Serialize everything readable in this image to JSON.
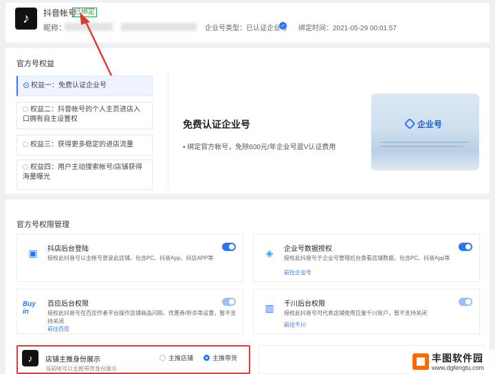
{
  "account": {
    "name": "抖音帐号",
    "badge": "已绑定",
    "nickname_label": "昵称：",
    "type_label": "企业号类型：已认证企业号",
    "bind_time": "绑定时间：2021-05-29 00:01:57"
  },
  "rights": {
    "title": "官方号权益",
    "tabs": [
      {
        "label": "权益一：免费认证企业号"
      },
      {
        "label": "权益二：抖音帐号的个人主页进店入口拥有自主设置权"
      },
      {
        "label": "权益三：获得更多稳定的进店流量"
      },
      {
        "label": "权益四：用户主动搜索帐号/店铺获得海量曝光"
      }
    ],
    "benefit_title": "免费认证企业号",
    "benefit_desc": "• 绑定官方帐号，免除600元/年企业号蓝V认证费用",
    "promo_logo": "企业号"
  },
  "permissions": {
    "title": "官方号权限管理",
    "cards": [
      {
        "title": "抖店后台登陆",
        "desc": "授权此抖音号以主帐号登录此店铺，包含PC、抖音App、抖店APP等",
        "link": "",
        "icon": "doudian-icon"
      },
      {
        "title": "企业号数据授权",
        "desc": "授权此抖音号于企业号管理后台查看店铺数据，包含PC、抖音App等",
        "link": "前往企业号",
        "icon": "enterprise-icon"
      },
      {
        "title": "百应后台权限",
        "desc": "授权此抖音号在百应作者平台操作店铺商品闪购、优惠券/秒杀等设置，暂不支持关闭",
        "link": "前往百应",
        "icon": "buyin-icon"
      },
      {
        "title": "千川后台权限",
        "desc": "授权此抖音号可代表店铺使用巨量千川账户，暂不支持关闭",
        "link": "前往千川",
        "icon": "qianchuan-icon"
      }
    ],
    "store_identity": {
      "title": "店铺主推身份展示",
      "desc": "当前帐号以主推带货身份展示",
      "options": [
        "主推店铺",
        "主推带货"
      ],
      "selected": "主推带货"
    }
  },
  "watermark": {
    "name": "丰图软件园",
    "url": "www.dgfengtu.com"
  }
}
